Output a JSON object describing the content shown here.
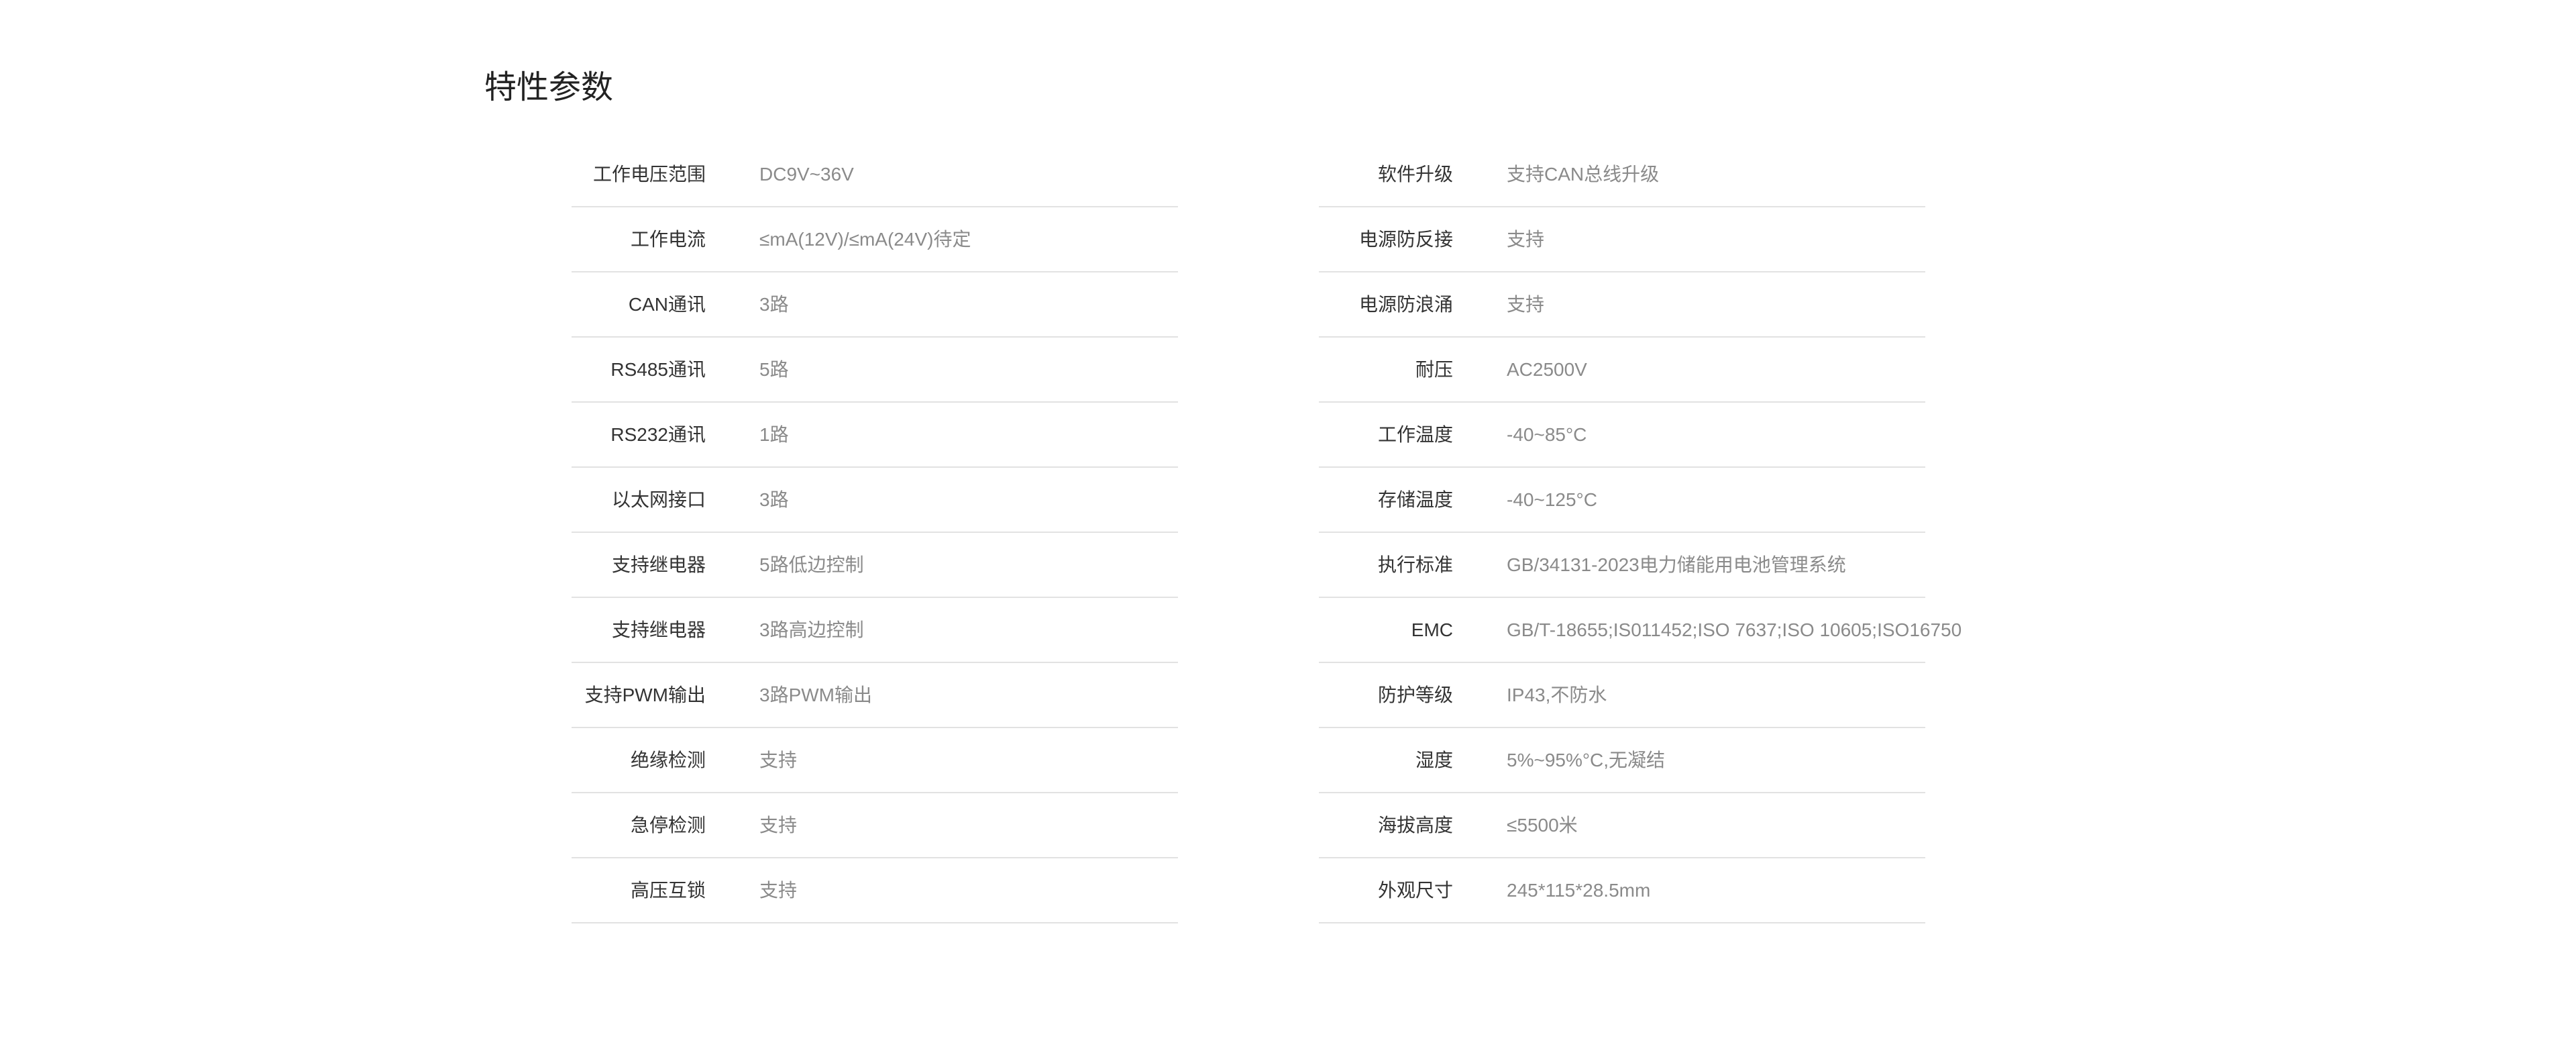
{
  "page": {
    "title": "特性参数"
  },
  "specs_left": [
    {
      "label": "工作电压范围",
      "value": "DC9V~36V"
    },
    {
      "label": "工作电流",
      "value": "≤mA(12V)/≤mA(24V)待定"
    },
    {
      "label": "CAN通讯",
      "value": "3路"
    },
    {
      "label": "RS485通讯",
      "value": "5路"
    },
    {
      "label": "RS232通讯",
      "value": "1路"
    },
    {
      "label": "以太网接口",
      "value": "3路"
    },
    {
      "label": "支持继电器",
      "value": "5路低边控制"
    },
    {
      "label": "支持继电器",
      "value": "3路高边控制"
    },
    {
      "label": "支持PWM输出",
      "value": "3路PWM输出"
    },
    {
      "label": "绝缘检测",
      "value": "支持"
    },
    {
      "label": "急停检测",
      "value": "支持"
    },
    {
      "label": "高压互锁",
      "value": "支持"
    }
  ],
  "specs_right": [
    {
      "label": "软件升级",
      "value": "支持CAN总线升级"
    },
    {
      "label": "电源防反接",
      "value": "支持"
    },
    {
      "label": "电源防浪涌",
      "value": "支持"
    },
    {
      "label": "耐压",
      "value": "AC2500V"
    },
    {
      "label": "工作温度",
      "value": "-40~85°C"
    },
    {
      "label": "存储温度",
      "value": "-40~125°C"
    },
    {
      "label": "执行标准",
      "value": "GB/34131-2023电力储能用电池管理系统"
    },
    {
      "label": "EMC",
      "value": "GB/T-18655;IS011452;ISO 7637;ISO 10605;ISO16750"
    },
    {
      "label": "防护等级",
      "value": "IP43,不防水"
    },
    {
      "label": "湿度",
      "value": "5%~95%°C,无凝结"
    },
    {
      "label": "海拔高度",
      "value": "≤5500米"
    },
    {
      "label": "外观尺寸",
      "value": "245*115*28.5mm"
    }
  ]
}
